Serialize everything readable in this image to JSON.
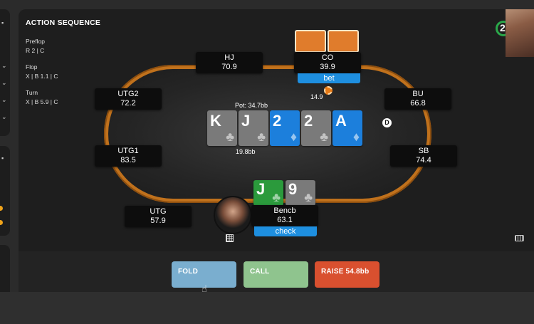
{
  "sequence": {
    "title": "ACTION SEQUENCE",
    "streets": [
      {
        "name": "Preflop",
        "actions": "R 2  |  C"
      },
      {
        "name": "Flop",
        "actions": "X  |  B 1.1  |  C"
      },
      {
        "name": "Turn",
        "actions": "X  |  B 5.9  |  C"
      }
    ]
  },
  "seats": {
    "hj": {
      "name": "HJ",
      "stack": "70.9"
    },
    "co": {
      "name": "CO",
      "stack": "39.9",
      "tag": "bet"
    },
    "utg2": {
      "name": "UTG2",
      "stack": "72.2"
    },
    "bu": {
      "name": "BU",
      "stack": "66.8"
    },
    "utg1": {
      "name": "UTG1",
      "stack": "83.5"
    },
    "sb": {
      "name": "SB",
      "stack": "74.4"
    },
    "utg": {
      "name": "UTG",
      "stack": "57.9"
    },
    "hero": {
      "name": "Bencb",
      "stack": "63.1",
      "tag": "check"
    }
  },
  "pot": {
    "label": "Pot: 34.7bb",
    "center_bet": "19.8bb",
    "co_bet": "14.9"
  },
  "dealer_button": "D",
  "board": [
    {
      "rank": "K",
      "suit": "♣",
      "color": "gray"
    },
    {
      "rank": "J",
      "suit": "♣",
      "color": "gray"
    },
    {
      "rank": "2",
      "suit": "♦",
      "color": "blue"
    },
    {
      "rank": "2",
      "suit": "♣",
      "color": "gray"
    },
    {
      "rank": "A",
      "suit": "♦",
      "color": "blue"
    }
  ],
  "hero_cards": [
    {
      "rank": "J",
      "suit": "♣",
      "color": "green"
    },
    {
      "rank": "9",
      "suit": "♣",
      "color": "gray"
    }
  ],
  "buttons": {
    "fold": "FOLD",
    "call": "CALL",
    "raise": "RAISE 54.8bb"
  },
  "timer": "2",
  "colors": {
    "fold": "#7aaecf",
    "call": "#8fc48e",
    "raise": "#d9502f",
    "table_rail": "#c0711c",
    "tag": "#1e8fe0"
  }
}
